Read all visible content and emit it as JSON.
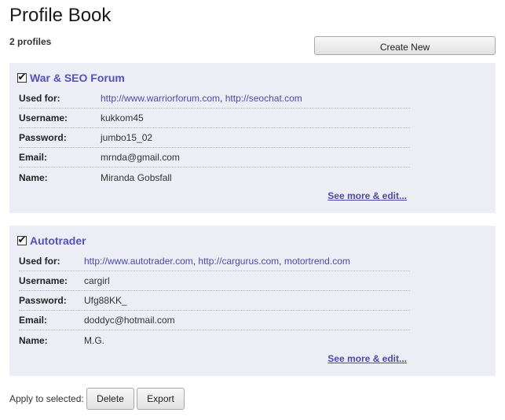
{
  "page": {
    "title": "Profile Book",
    "profile_count": "2 profiles",
    "create_new_label": "Create New"
  },
  "profiles": [
    {
      "checked": true,
      "name": "War & SEO Forum",
      "fields": {
        "used_for_label": "Used for:",
        "used_for": [
          "http://www.warriorforum.com",
          "http://seochat.com"
        ],
        "username_label": "Username:",
        "username": "kukkom45",
        "password_label": "Password:",
        "password": "jumbo15_02",
        "email_label": "Email:",
        "email": "mrnda@gmail.com",
        "name_label": "Name:",
        "name": "Miranda Gobsfall"
      },
      "see_more_label": "See more & edit..."
    },
    {
      "checked": true,
      "name": "Autotrader",
      "fields": {
        "used_for_label": "Used for:",
        "used_for": [
          "http://www.autotrader.com",
          "http://cargurus.com",
          "motortrend.com"
        ],
        "username_label": "Username:",
        "username": "cargirl",
        "password_label": "Password:",
        "password": "Ufg88KK_",
        "email_label": "Email:",
        "email": "doddyc@hotmail.com",
        "name_label": "Name:",
        "name": "M.G."
      },
      "see_more_label": "See more & edit..."
    }
  ],
  "actions": {
    "apply_label": "Apply to selected:",
    "delete_label": "Delete",
    "export_label": "Export"
  },
  "separator": ",",
  "icons": {
    "checkbox": "checkbox-checked-icon",
    "check_glyph": "✔"
  },
  "colors": {
    "card_bg": "#ededf6",
    "link": "#4a4aa8",
    "title_link": "#5252b8"
  }
}
